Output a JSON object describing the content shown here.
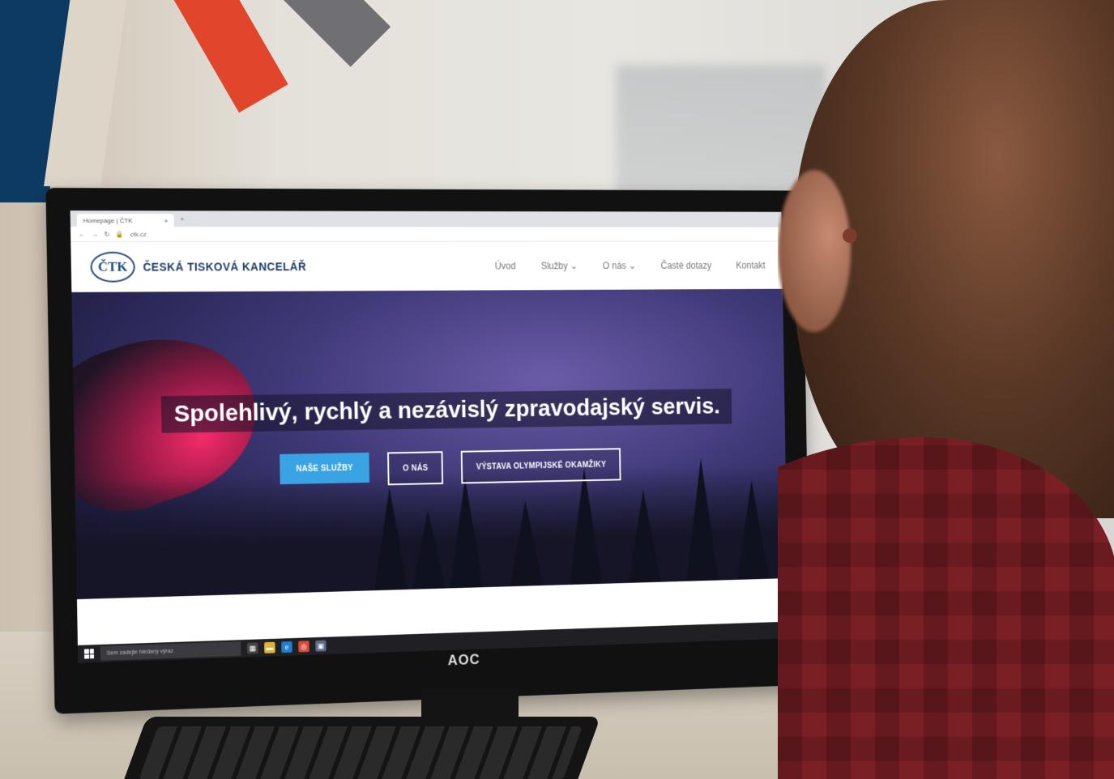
{
  "browser": {
    "tab_title": "Homepage | ČTK",
    "tab_close": "×",
    "new_tab": "+",
    "address": "ctk.cz"
  },
  "site": {
    "logo_badge": "ČTK",
    "logo_text": "ČESKÁ TISKOVÁ KANCELÁŘ",
    "nav": [
      "Úvod",
      "Služby",
      "O nás",
      "Časté dotazy",
      "Kontakt"
    ],
    "hero_title": "Spolehlivý, rychlý a nezávislý zpravodajský servis.",
    "buttons": [
      "NAŠE SLUŽBY",
      "O NÁS",
      "VÝSTAVA OLYMPIJSKÉ OKAMŽIKY"
    ]
  },
  "taskbar": {
    "search_placeholder": "Sem zadejte hledaný výraz"
  },
  "monitor": {
    "brand": "AOC"
  },
  "colors": {
    "navy": "#0d3a63",
    "beige": "#ddd5c7",
    "red": "#e1462c",
    "gray": "#6f6f74",
    "button_blue": "#3aa3e3",
    "brand_blue": "#1c4c7d"
  }
}
